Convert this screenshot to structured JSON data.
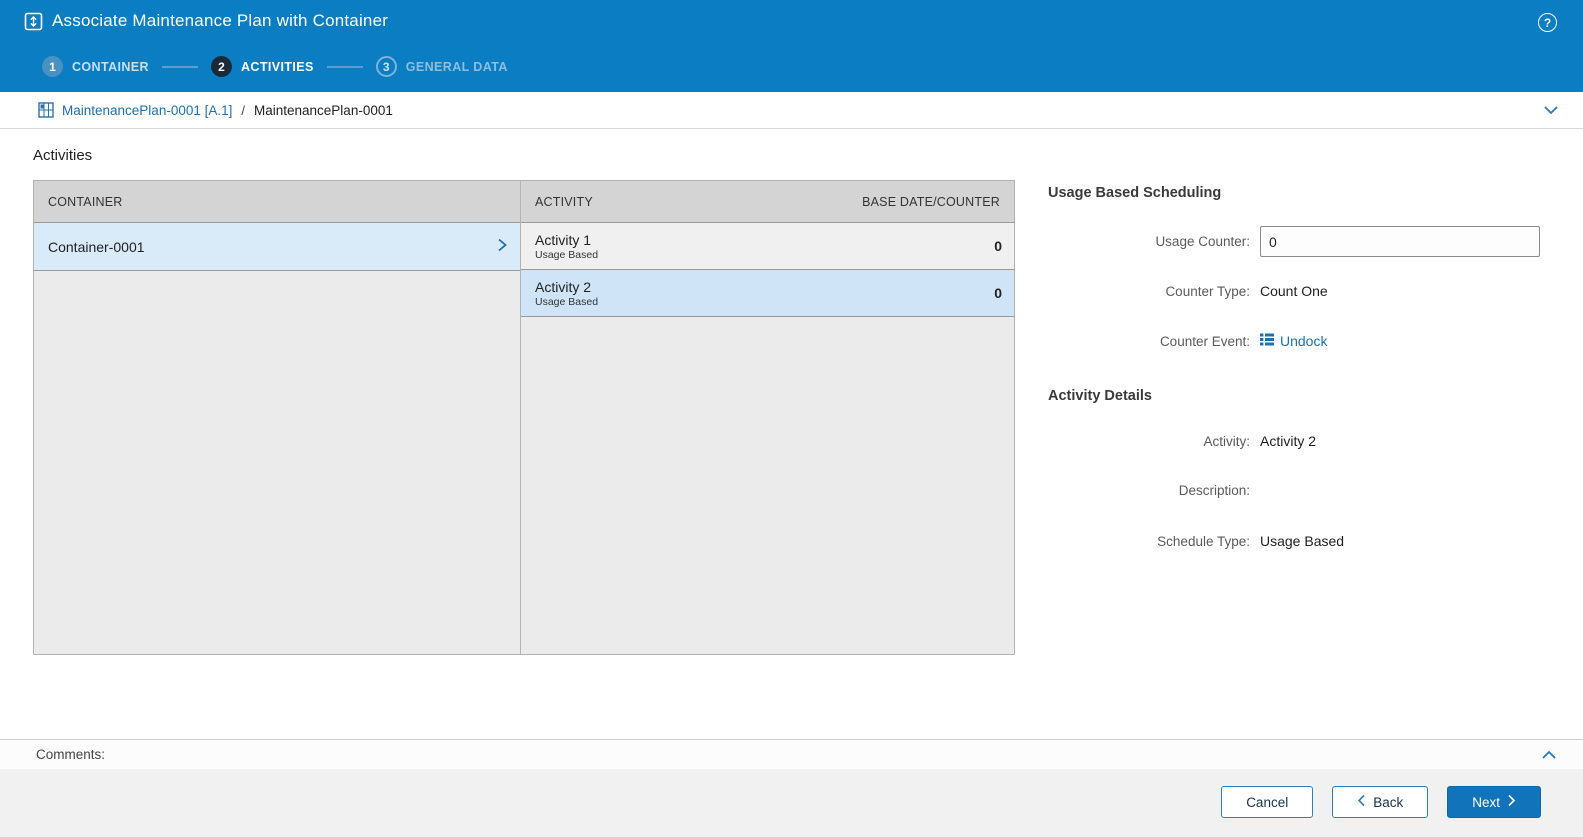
{
  "header": {
    "title": "Associate Maintenance Plan with Container",
    "steps": [
      {
        "number": "1",
        "label": "CONTAINER"
      },
      {
        "number": "2",
        "label": "ACTIVITIES"
      },
      {
        "number": "3",
        "label": "GENERAL DATA"
      }
    ],
    "help_glyph": "?"
  },
  "breadcrumb": {
    "link": "MaintenancePlan-0001 [A.1]",
    "separator": "/",
    "current": "MaintenancePlan-0001"
  },
  "main": {
    "activities_title": "Activities",
    "table": {
      "container_header": "CONTAINER",
      "activity_header": "ACTIVITY",
      "base_header": "BASE DATE/COUNTER",
      "containers": [
        {
          "name": "Container-0001"
        }
      ],
      "activities": [
        {
          "name": "Activity 1",
          "type": "Usage Based",
          "value": "0"
        },
        {
          "name": "Activity 2",
          "type": "Usage Based",
          "value": "0"
        }
      ]
    },
    "details": {
      "scheduling_title": "Usage Based Scheduling",
      "usage_counter_label": "Usage Counter:",
      "usage_counter_value": "0",
      "counter_type_label": "Counter Type:",
      "counter_type_value": "Count One",
      "counter_event_label": "Counter Event:",
      "counter_event_value": "Undock",
      "activity_details_title": "Activity Details",
      "activity_label": "Activity:",
      "activity_value": "Activity 2",
      "description_label": "Description:",
      "description_value": "",
      "schedule_type_label": "Schedule Type:",
      "schedule_type_value": "Usage Based"
    }
  },
  "comments": {
    "label": "Comments:"
  },
  "footer": {
    "cancel_label": "Cancel",
    "back_label": "Back",
    "next_label": "Next"
  },
  "colors": {
    "header_blue": "#0b7dc2",
    "accent_blue": "#1d6fb3",
    "selected_row": "#cfe5f7",
    "primary_button": "#1173b9"
  }
}
